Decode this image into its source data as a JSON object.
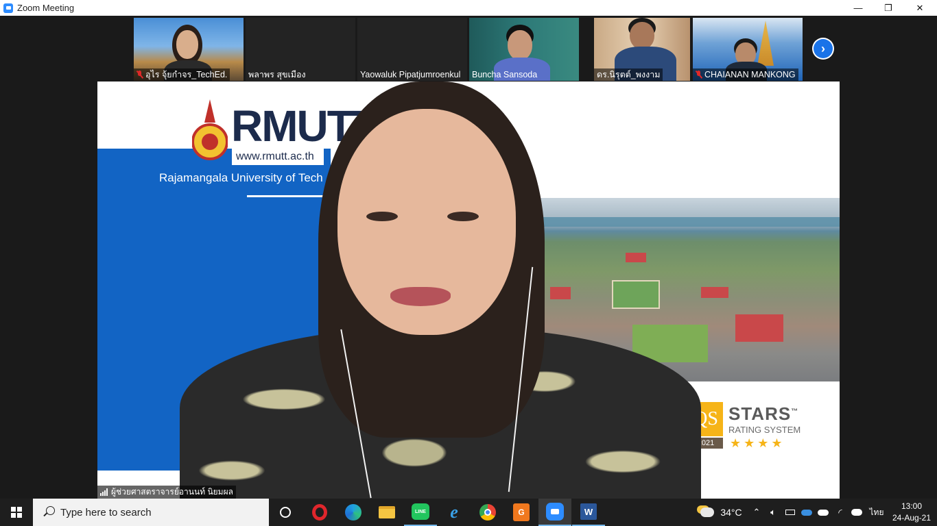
{
  "window": {
    "title": "Zoom Meeting",
    "minimize_glyph": "—",
    "maximize_glyph": "❐",
    "close_glyph": "✕"
  },
  "participants": [
    {
      "name": "อุไร จุ้ยกำจร_TechEd.",
      "muted": true
    },
    {
      "name": "พลาพร สุขเมือง",
      "muted": false
    },
    {
      "name": "Yaowaluk Pipatjumroenkul",
      "muted": false
    },
    {
      "name": "Buncha Sansoda",
      "muted": false
    },
    {
      "name": "ดร.นิรุตต์_พงงาม",
      "muted": false
    },
    {
      "name": "CHAIANAN MANKONG",
      "muted": true
    }
  ],
  "active_speaker": {
    "name": "ผู้ช่วยศาสตราจารย์อานนท์ นิยมผล"
  },
  "virtual_background": {
    "logo": "RMUTT",
    "url": "www.rmutt.ac.th",
    "university": "Rajamangala University of Tech",
    "qs_box": "QS",
    "qs_year": "2021",
    "qs_title": "STARS",
    "qs_tm": "™",
    "qs_subtitle": "RATING SYSTEM",
    "qs_stars": "★★★★"
  },
  "taskbar": {
    "search_placeholder": "Type here to search",
    "weather_temp": "34°C",
    "language": "ไทย",
    "time": "13:00",
    "date": "24-Aug-21"
  },
  "colors": {
    "zoom_blue": "#2d8cff",
    "brand_blue": "#1264c4",
    "qs_gold": "#f6b418"
  }
}
